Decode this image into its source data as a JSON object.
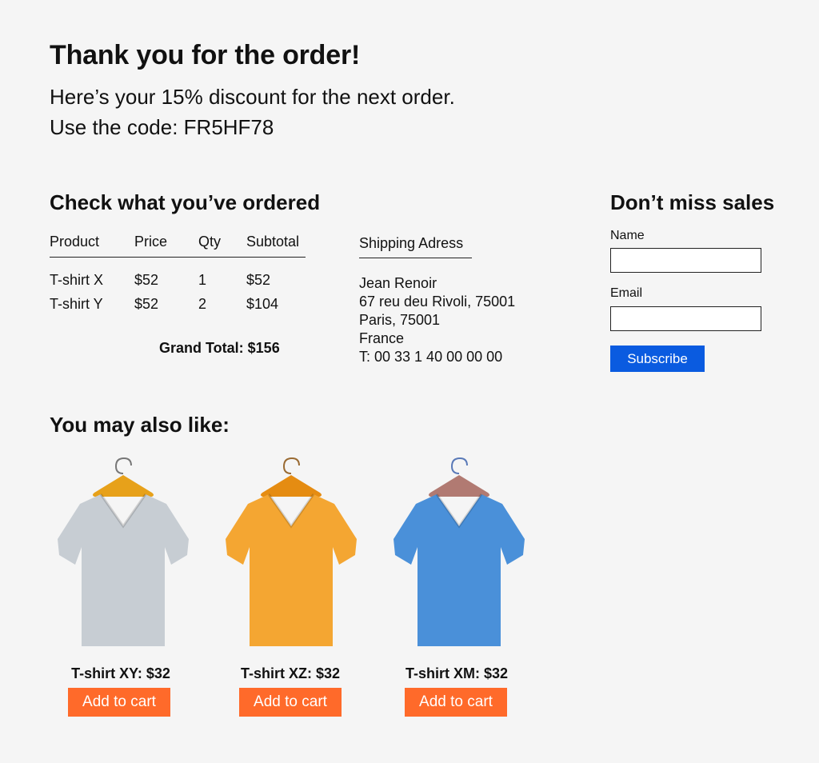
{
  "header": {
    "title": "Thank you for the order!",
    "discount_line": "Here’s your 15% discount for the next order.",
    "code_line": "Use the code: FR5HF78"
  },
  "order": {
    "heading": "Check what you’ve ordered",
    "columns": [
      "Product",
      "Price",
      "Qty",
      "Subtotal"
    ],
    "rows": [
      [
        "T-shirt X",
        "$52",
        "1",
        "$52"
      ],
      [
        "T-shirt Y",
        "$52",
        "2",
        "$104"
      ]
    ],
    "grand_total": "Grand Total: $156"
  },
  "shipping": {
    "heading": "Shipping Adress",
    "lines": [
      "Jean Renoir",
      "67 reu deu Rivoli, 75001",
      "Paris, 75001",
      "France",
      "T: 00 33 1 40 00 00 00"
    ]
  },
  "newsletter": {
    "heading": "Don’t miss sales",
    "name_label": "Name",
    "name_value": "",
    "email_label": "Email",
    "email_value": "",
    "subscribe_label": "Subscribe",
    "button_color": "#0a5be0"
  },
  "recommend": {
    "heading": "You may also like:",
    "add_to_cart_color": "#ff6a2a",
    "products": [
      {
        "name": "T-shirt XY: $32",
        "button": "Add to cart",
        "shirt_color": "#c7cdd3",
        "hanger_color": "#e7a11a",
        "hook_color": "#777"
      },
      {
        "name": "T-shirt XZ: $32",
        "button": "Add to cart",
        "shirt_color": "#f4a632",
        "hanger_color": "#e58c12",
        "hook_color": "#9a6b33"
      },
      {
        "name": "T-shirt XM: $32",
        "button": "Add to cart",
        "shirt_color": "#4a90d9",
        "hanger_color": "#b17a72",
        "hook_color": "#5a7ab8"
      }
    ]
  }
}
